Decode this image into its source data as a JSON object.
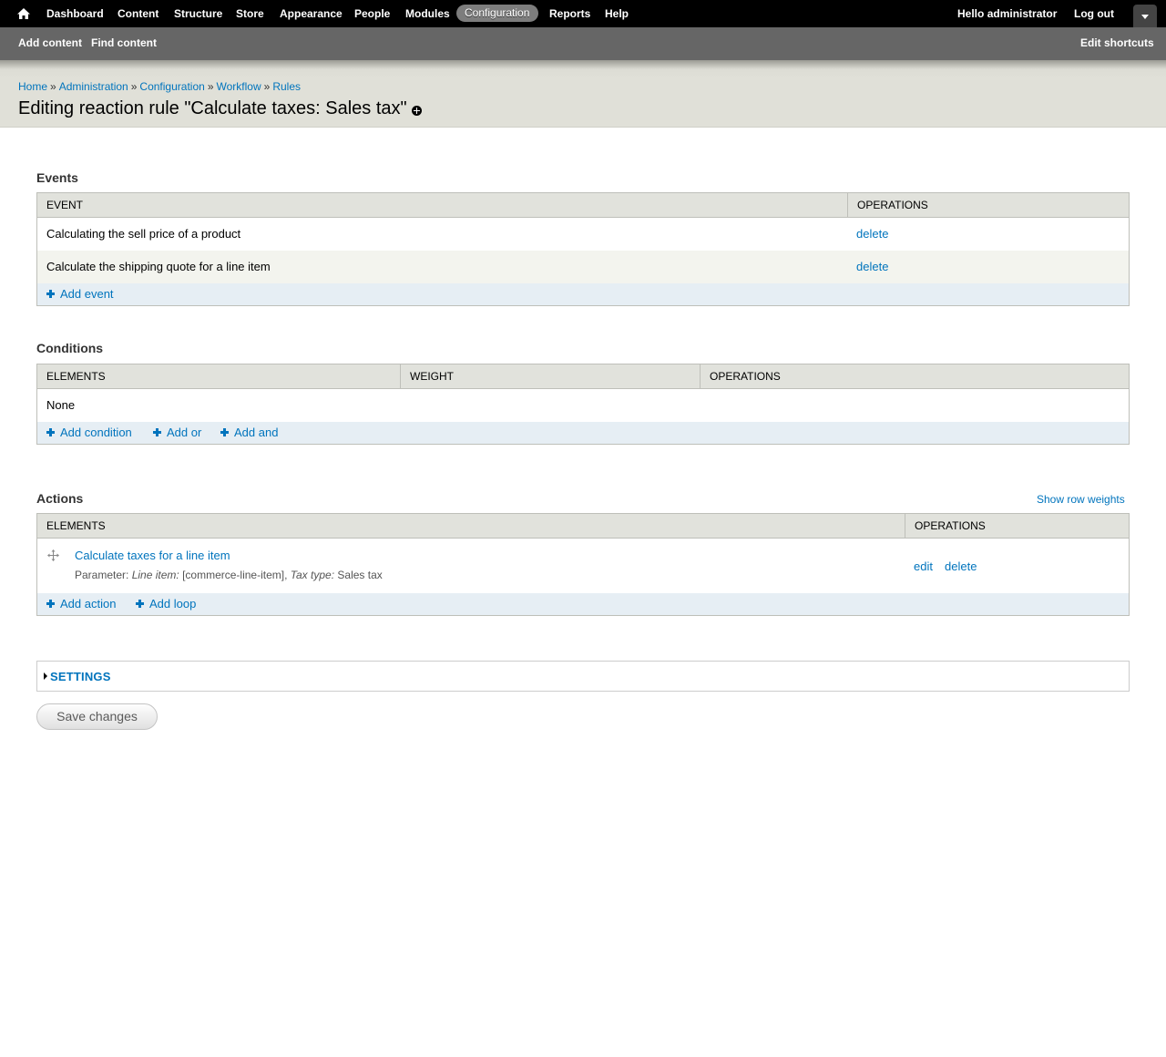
{
  "toolbar": {
    "home_icon": "home-icon",
    "menu": [
      {
        "label": "Dashboard",
        "active": false
      },
      {
        "label": "Content",
        "active": false
      },
      {
        "label": "Structure",
        "active": false
      },
      {
        "label": "Store",
        "active": false
      },
      {
        "label": "Appearance",
        "active": false
      },
      {
        "label": "People",
        "active": false
      },
      {
        "label": "Modules",
        "active": false
      },
      {
        "label": "Configuration",
        "active": true
      },
      {
        "label": "Reports",
        "active": false
      },
      {
        "label": "Help",
        "active": false
      }
    ],
    "hello_prefix": "Hello",
    "username": "administrator",
    "logout": "Log out"
  },
  "shortcuts": {
    "items": [
      "Add content",
      "Find content"
    ],
    "edit": "Edit shortcuts"
  },
  "breadcrumb": [
    "Home",
    "Administration",
    "Configuration",
    "Workflow",
    "Rules"
  ],
  "breadcrumb_separator": "»",
  "page_title": "Editing reaction rule \"Calculate taxes: Sales tax\"",
  "events": {
    "title": "Events",
    "headers": [
      "EVENT",
      "OPERATIONS"
    ],
    "rows": [
      {
        "event": "Calculating the sell price of a product",
        "op": "delete"
      },
      {
        "event": "Calculate the shipping quote for a line item",
        "op": "delete"
      }
    ],
    "add_links": [
      "Add event"
    ]
  },
  "conditions": {
    "title": "Conditions",
    "headers": [
      "ELEMENTS",
      "WEIGHT",
      "OPERATIONS"
    ],
    "empty": "None",
    "add_links": [
      "Add condition",
      "Add or",
      "Add and"
    ]
  },
  "actions": {
    "title": "Actions",
    "show_row_weights": "Show row weights",
    "headers": [
      "ELEMENTS",
      "OPERATIONS"
    ],
    "rows": [
      {
        "label": "Calculate taxes for a line item",
        "param_prefix": "Parameter:",
        "param1_name": "Line item:",
        "param1_value": "[commerce-line-item],",
        "param2_name": "Tax type:",
        "param2_value": "Sales tax",
        "edit": "edit",
        "delete": "delete"
      }
    ],
    "add_links": [
      "Add action",
      "Add loop"
    ]
  },
  "settings": {
    "label": "SETTINGS"
  },
  "save_button": "Save changes",
  "colors": {
    "link": "#0074bd",
    "toolbar": "#000000",
    "shortcut_bar": "#666666",
    "header_bg": "#e0e0d8"
  }
}
